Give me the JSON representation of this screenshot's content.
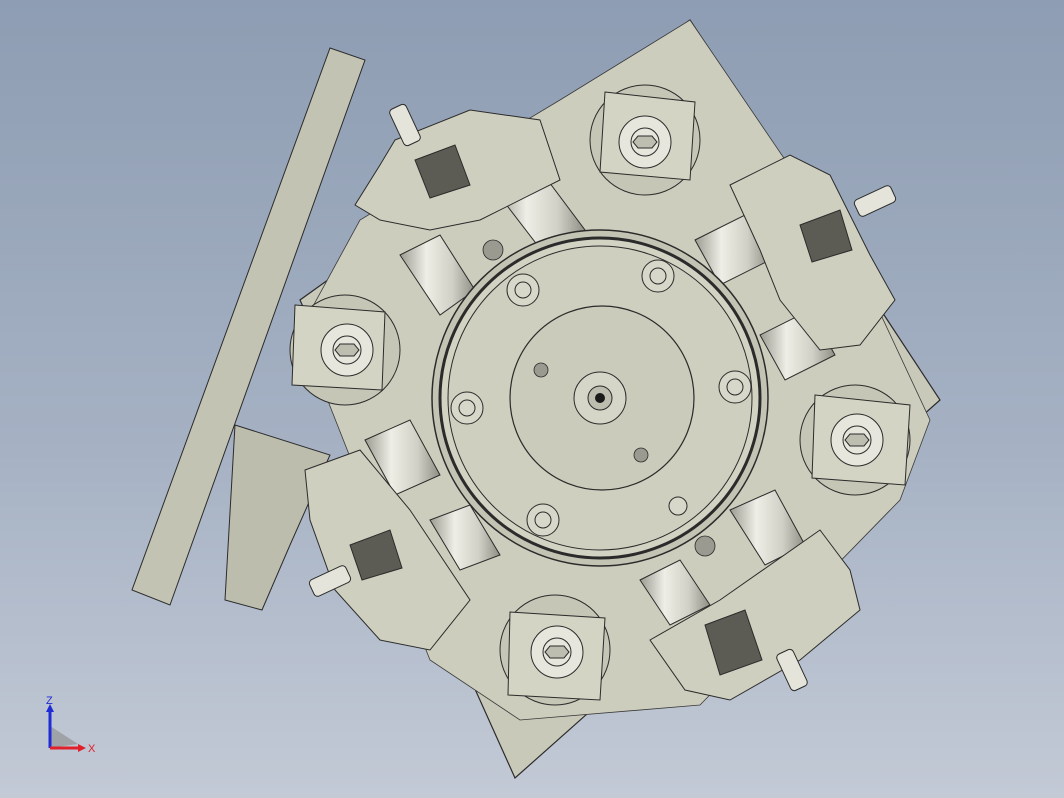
{
  "viewport": {
    "background_top": "#8e9db3",
    "background_bottom": "#c3cad6"
  },
  "model": {
    "part_color": "#c9c9b9",
    "part_shade": "#b7b7a7",
    "edge_color": "#2b2b2b",
    "cylinder_color": "#d6d6cc",
    "dark_block_color": "#5c5c55"
  },
  "triad": {
    "z_label": "Z",
    "x_label": "X",
    "z_color": "#1f2bd6",
    "x_color": "#e0202a"
  }
}
